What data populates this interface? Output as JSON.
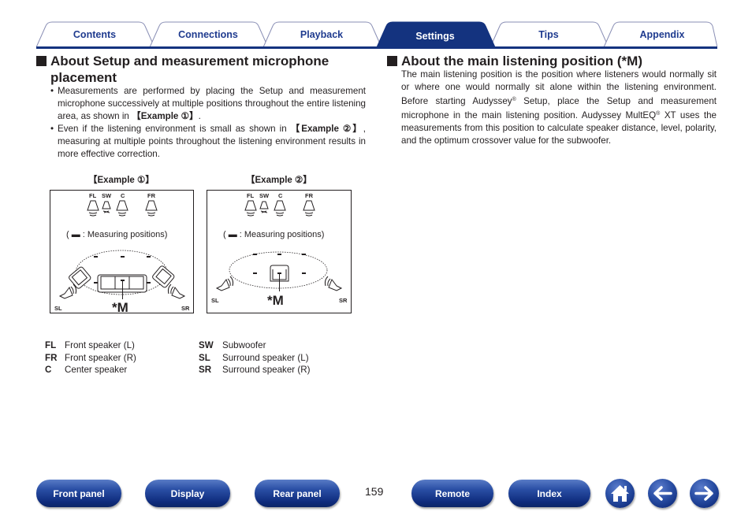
{
  "tabs": [
    {
      "label": "Contents",
      "active": false
    },
    {
      "label": "Connections",
      "active": false
    },
    {
      "label": "Playback",
      "active": false
    },
    {
      "label": "Settings",
      "active": true
    },
    {
      "label": "Tips",
      "active": false
    },
    {
      "label": "Appendix",
      "active": false
    }
  ],
  "colors": {
    "accent": "#14337f",
    "text": "#231f20"
  },
  "left": {
    "heading_line1": "About Setup and measurement microphone",
    "heading_line2": "placement",
    "bullet1_pre": "Measurements are performed by placing the Setup and measurement microphone successively at multiple positions throughout the entire listening area, as shown in ",
    "bullet1_ref": "【Example ①】",
    "bullet1_post": ".",
    "bullet2_pre": "Even if the listening environment is small as shown in ",
    "bullet2_ref": "【Example ②】",
    "bullet2_post": ", measuring at multiple points throughout the listening environment results in more effective correction."
  },
  "right": {
    "heading": "About the main listening position (*M)",
    "para_1": "The main listening position is the position where listeners would normally sit or where one would normally sit alone within the listening environment. Before starting Audyssey",
    "reg1": "®",
    "para_2": " Setup, place the Setup and measurement microphone in the main listening position. Audyssey MultEQ",
    "reg2": "®",
    "para_3": " XT uses the measurements from this position to calculate speaker distance, level, polarity, and the optimum crossover value for the subwoofer."
  },
  "examples": [
    {
      "label": "【Example ①】",
      "note": "( ▬ : Measuring positions)",
      "speakers": {
        "fl": "FL",
        "sw": "SW",
        "c": "C",
        "fr": "FR",
        "sl": "SL",
        "sr": "SR"
      },
      "main_position": "*M",
      "measuring_positions": 6
    },
    {
      "label": "【Example ②】",
      "note": "( ▬ : Measuring positions)",
      "speakers": {
        "fl": "FL",
        "sw": "SW",
        "c": "C",
        "fr": "FR",
        "sl": "SL",
        "sr": "SR"
      },
      "main_position": "*M",
      "measuring_positions": 6
    }
  ],
  "legend": [
    {
      "abbr": "FL",
      "desc": "Front speaker (L)"
    },
    {
      "abbr": "FR",
      "desc": "Front speaker (R)"
    },
    {
      "abbr": "C",
      "desc": "Center speaker"
    },
    {
      "abbr": "SW",
      "desc": "Subwoofer"
    },
    {
      "abbr": "SL",
      "desc": "Surround speaker (L)"
    },
    {
      "abbr": "SR",
      "desc": "Surround speaker (R)"
    }
  ],
  "bottom_nav": {
    "front_panel": "Front panel",
    "display": "Display",
    "rear_panel": "Rear panel",
    "page_number": "159",
    "remote": "Remote",
    "index": "Index",
    "home_icon": "home-icon",
    "back_icon": "arrow-left-icon",
    "forward_icon": "arrow-right-icon"
  }
}
